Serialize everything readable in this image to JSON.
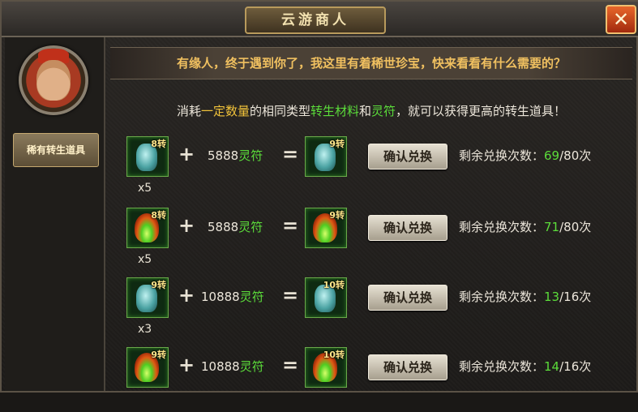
{
  "window": {
    "title": "云游商人",
    "close_glyph": "✕"
  },
  "sidebar": {
    "avatar_label": "merchant-portrait",
    "tab_label": "稀有转生道具"
  },
  "banner": {
    "text": "有缘人，终于遇到你了，我这里有着稀世珍宝，快来看看有什么需要的？"
  },
  "description": {
    "p1": "消耗",
    "p2": "一定数量",
    "p3": "的相同类型",
    "p4": "转生材料",
    "p5": "和",
    "p6": "灵符",
    "p7": "，就可以获得更高的转生道具！"
  },
  "rows": [
    {
      "input_item": "blue-gem",
      "input_tier": "8转",
      "input_qty": "x5",
      "plus": "+",
      "cost_amount": "5888",
      "cost_unit": "灵符",
      "equals": "=",
      "output_item": "blue-gem",
      "output_tier": "9转",
      "button": "确认兑换",
      "remain_label": "剩余兑换次数：",
      "remain_used": "69",
      "remain_total": "/80次"
    },
    {
      "input_item": "fire-gem",
      "input_tier": "8转",
      "input_qty": "x5",
      "plus": "+",
      "cost_amount": "5888",
      "cost_unit": "灵符",
      "equals": "=",
      "output_item": "fire-gem",
      "output_tier": "9转",
      "button": "确认兑换",
      "remain_label": "剩余兑换次数：",
      "remain_used": "71",
      "remain_total": "/80次"
    },
    {
      "input_item": "blue-gem",
      "input_tier": "9转",
      "input_qty": "x3",
      "plus": "+",
      "cost_amount": "10888",
      "cost_unit": "灵符",
      "equals": "=",
      "output_item": "blue-gem",
      "output_tier": "10转",
      "button": "确认兑换",
      "remain_label": "剩余兑换次数：",
      "remain_used": "13",
      "remain_total": "/16次"
    },
    {
      "input_item": "fire-gem",
      "input_tier": "9转",
      "input_qty": "",
      "plus": "+",
      "cost_amount": "10888",
      "cost_unit": "灵符",
      "equals": "=",
      "output_item": "fire-gem",
      "output_tier": "10转",
      "button": "确认兑换",
      "remain_label": "剩余兑换次数：",
      "remain_used": "14",
      "remain_total": "/16次"
    }
  ],
  "colors": {
    "accent_green": "#5bdc3a",
    "accent_yellow": "#f0c23a",
    "banner_text": "#f0c060"
  }
}
